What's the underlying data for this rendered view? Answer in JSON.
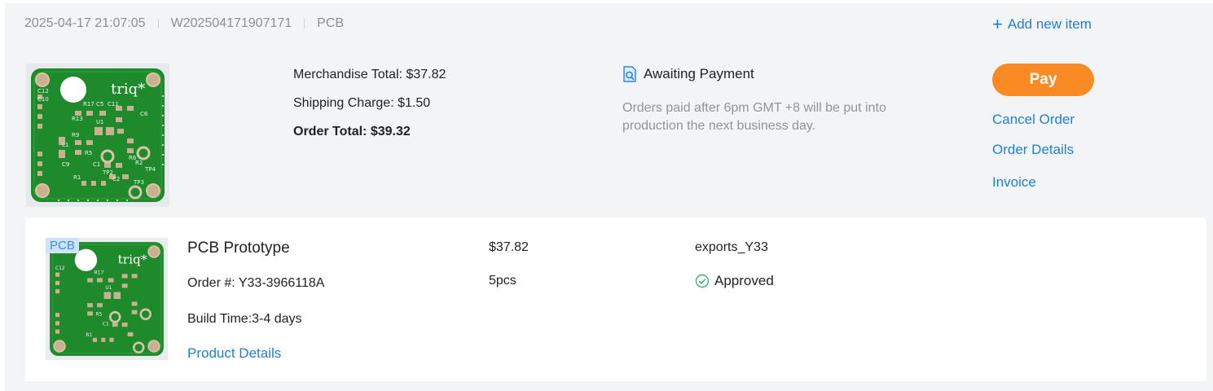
{
  "order": {
    "datetime": "2025-04-17 21:07:05",
    "order_no": "W202504171907171",
    "type": "PCB",
    "add_item_label": "Add new item",
    "merchandise_total": "Merchandise Total: $37.82",
    "shipping_charge": "Shipping Charge: $1.50",
    "order_total": "Order Total: $39.32",
    "status": "Awaiting Payment",
    "note": "Orders paid after 6pm GMT +8 will be put into production the next business day.",
    "actions": {
      "pay": "Pay",
      "cancel": "Cancel Order",
      "details": "Order Details",
      "invoice": "Invoice"
    }
  },
  "item": {
    "tag": "PCB",
    "title": "PCB Prototype",
    "order_label": "Order #: Y33-3966118A",
    "build_time": "Build Time:3-4 days",
    "details_link": "Product Details",
    "price": "$37.82",
    "quantity": "5pcs",
    "files": "exports_Y33",
    "review_status": "Approved"
  },
  "board_image": {
    "logo_text": "triq*",
    "silkscreen": [
      "C12",
      "C10",
      "R17",
      "C5",
      "C11",
      "U1",
      "R13",
      "C6",
      "R9",
      "L1",
      "R5",
      "R6",
      "C9",
      "C1",
      "TP2",
      "R2",
      "TP4",
      "R1",
      "C2",
      "TP3",
      "R19",
      "R18",
      "R10"
    ]
  },
  "colors": {
    "accent": "#1e7fd8",
    "pay_button": "#f98a24",
    "success": "#3cb371",
    "pcb_green": "#1f8a2b"
  }
}
